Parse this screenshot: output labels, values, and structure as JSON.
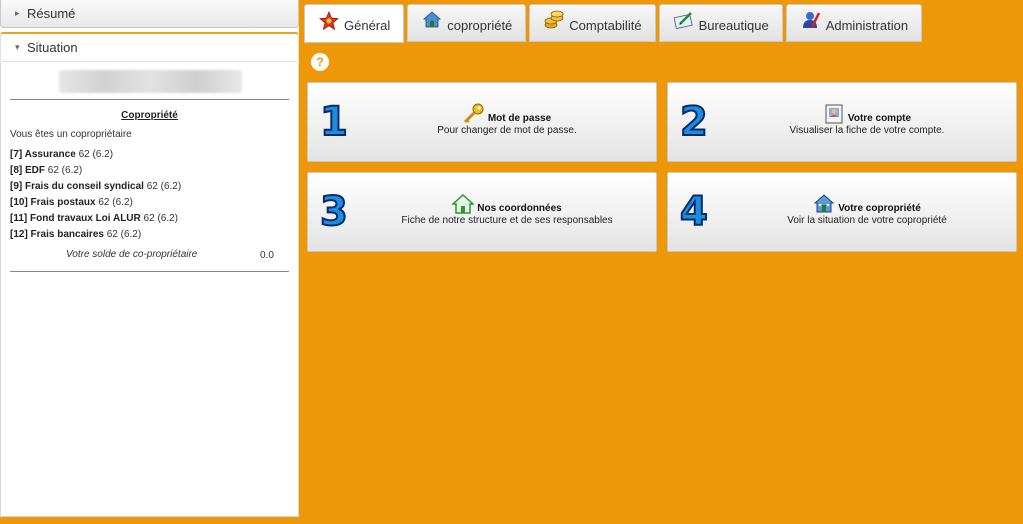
{
  "sidebar": {
    "resume_label": "Résumé",
    "situation_label": "Situation",
    "section_title": "Copropriété",
    "owner_text": "Vous êtes un copropriétaire",
    "charges": [
      {
        "name": "[7] Assurance",
        "value": "62 (6.2)"
      },
      {
        "name": "[8] EDF",
        "value": "62 (6.2)"
      },
      {
        "name": "[9] Frais du conseil syndical",
        "value": "62 (6.2)"
      },
      {
        "name": "[10] Frais postaux",
        "value": "62 (6.2)"
      },
      {
        "name": "[11] Fond travaux Loi ALUR",
        "value": "62 (6.2)"
      },
      {
        "name": "[12] Frais bancaires",
        "value": "62 (6.2)"
      }
    ],
    "balance_label": "Votre solde de co-propriétaire",
    "balance_value": "0.0"
  },
  "tabs": [
    {
      "label": "Général",
      "icon": "star-icon",
      "active": true
    },
    {
      "label": "copropriété",
      "icon": "house-icon",
      "active": false
    },
    {
      "label": "Comptabilité",
      "icon": "coins-icon",
      "active": false
    },
    {
      "label": "Bureautique",
      "icon": "card-pen-icon",
      "active": false
    },
    {
      "label": "Administration",
      "icon": "admin-icon",
      "active": false
    }
  ],
  "help_glyph": "?",
  "cards": [
    {
      "number": "1",
      "title": "Mot de passe",
      "desc": "Pour changer de mot de passe.",
      "icon": "key-icon"
    },
    {
      "number": "2",
      "title": "Votre compte",
      "desc": "Visualiser la fiche de votre compte.",
      "icon": "id-card-icon"
    },
    {
      "number": "3",
      "title": "Nos coordonnées",
      "desc": "Fiche de notre structure et de ses responsables",
      "icon": "green-house-icon"
    },
    {
      "number": "4",
      "title": "Votre copropriété",
      "desc": "Voir la situation de votre copropriété",
      "icon": "building-icon"
    }
  ],
  "colors": {
    "background": "#ee9807",
    "number": "#1a8fe0"
  }
}
